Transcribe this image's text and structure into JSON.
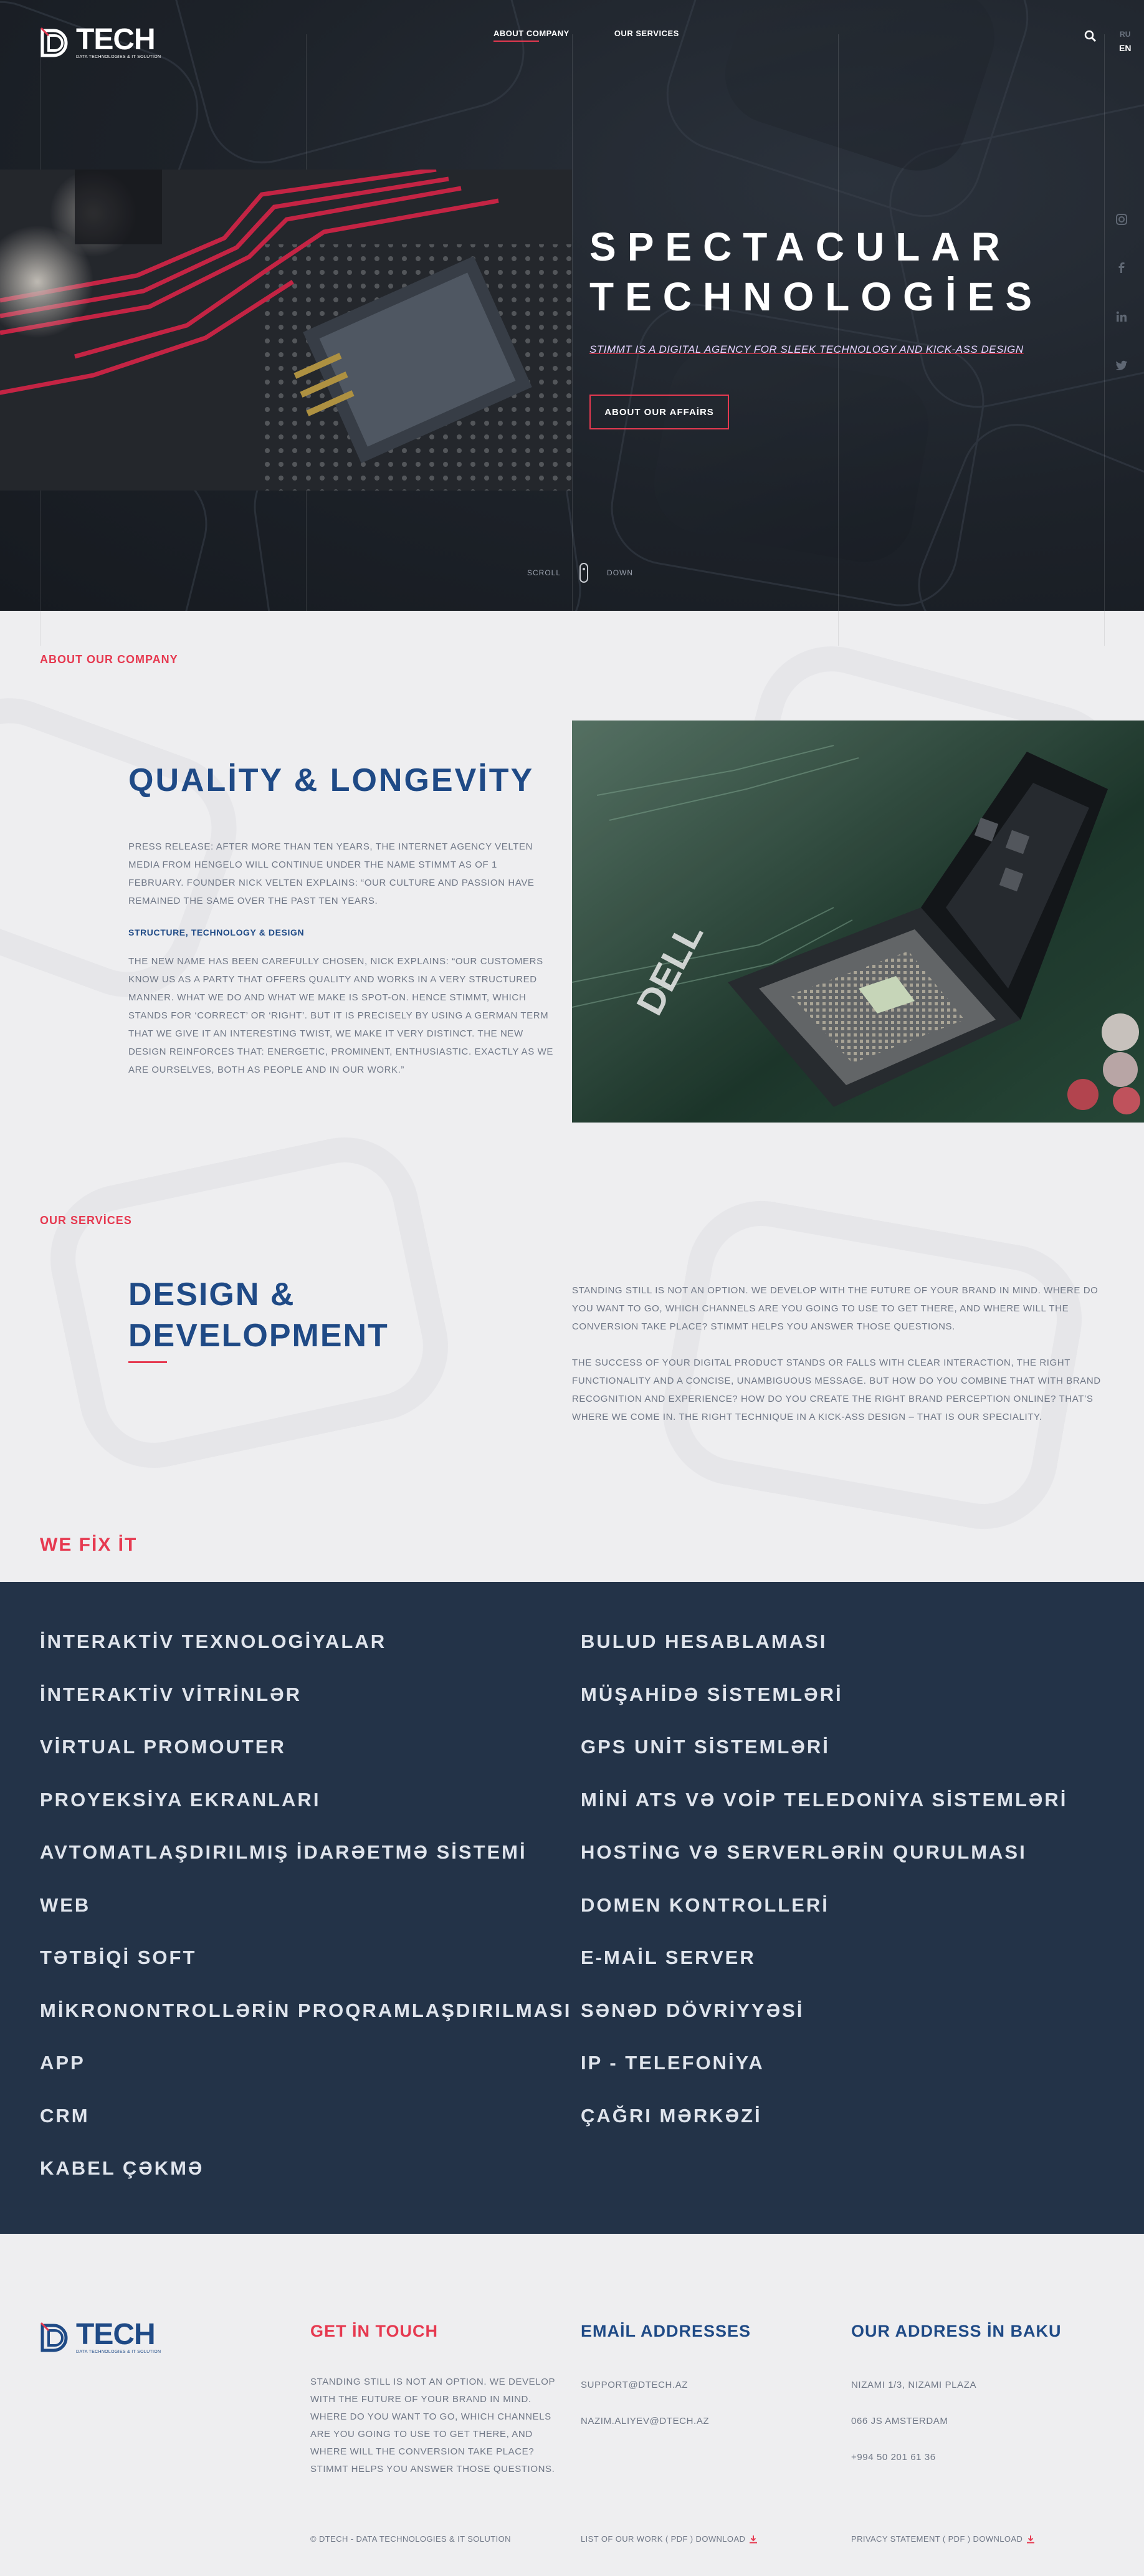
{
  "brand": {
    "word": "TECH",
    "tagline": "DATA TECHNOLOGIES & IT SOLUTION"
  },
  "nav": {
    "items": [
      "ABOUT COMPANY",
      "OUR SERVICES"
    ],
    "lang_other": "RU",
    "lang_active": "EN"
  },
  "hero": {
    "title_line1": "SPECTACULAR",
    "title_line2": "TECHNOLOGİES",
    "subtitle": "STIMMT IS A DIGITAL AGENCY FOR SLEEK TECHNOLOGY AND KICK-ASS DESIGN",
    "button": "ABOUT OUR AFFAİRS",
    "scroll_left": "SCROLL",
    "scroll_right": "DOWN"
  },
  "socials": [
    "instagram-icon",
    "facebook-icon",
    "linkedin-icon",
    "twitter-icon"
  ],
  "about": {
    "label": "ABOUT OUR COMPANY",
    "title": "QUALİTY & LONGEVİTY",
    "p1": "PRESS RELEASE: AFTER MORE THAN TEN YEARS, THE INTERNET AGENCY VELTEN MEDIA FROM HENGELO WILL CONTINUE UNDER THE NAME STIMMT AS OF 1 FEBRUARY. FOUNDER NICK VELTEN EXPLAINS: “OUR CULTURE AND PASSION HAVE REMAINED THE SAME OVER THE PAST TEN YEARS.",
    "subheading": "STRUCTURE, TECHNOLOGY & DESIGN",
    "p2": "THE NEW NAME HAS BEEN CAREFULLY CHOSEN, NICK EXPLAINS: “OUR CUSTOMERS KNOW US AS A PARTY THAT OFFERS QUALITY AND WORKS IN A VERY STRUCTURED MANNER. WHAT WE DO AND WHAT WE MAKE IS SPOT-ON. HENCE STIMMT, WHICH STANDS FOR ‘CORRECT’ OR ‘RIGHT’. BUT IT IS PRECISELY BY USING A GERMAN TERM THAT WE GIVE IT AN INTERESTING TWIST, WE MAKE IT VERY DISTINCT. THE NEW DESIGN REINFORCES THAT: ENERGETIC, PROMINENT, ENTHUSIASTIC. EXACTLY AS WE ARE OURSELVES, BOTH AS PEOPLE AND IN OUR WORK.”"
  },
  "services": {
    "label": "OUR SERVİCES",
    "title_line1": "DESIGN &",
    "title_line2": "DEVELOPMENT",
    "p1": "STANDING STILL IS NOT AN OPTION. WE DEVELOP WITH THE FUTURE OF YOUR BRAND IN MIND. WHERE DO YOU WANT TO GO, WHICH CHANNELS ARE YOU GOING TO USE TO GET THERE, AND WHERE WILL THE CONVERSION TAKE PLACE? STIMMT HELPS YOU ANSWER THOSE QUESTIONS.",
    "p2": "THE SUCCESS OF YOUR DIGITAL PRODUCT STANDS OR FALLS WITH CLEAR INTERACTION, THE RIGHT FUNCTIONALITY AND A CONCISE, UNAMBIGUOUS MESSAGE. BUT HOW DO YOU COMBINE THAT WITH BRAND RECOGNITION AND EXPERIENCE? HOW DO YOU CREATE THE RIGHT BRAND PERCEPTION ONLINE? THAT’S WHERE WE COME IN. THE RIGHT TECHNIQUE IN A KICK-ASS DESIGN – THAT IS OUR SPECIALITY."
  },
  "fix": {
    "label": "WE FİX İT",
    "left": [
      "İNTERAKTİV TEXNOLOGİYALAR",
      "İNTERAKTİV VİTRİNLƏR",
      "VİRTUAL PROMOUTER",
      "PROYEKSİYA EKRANLARI",
      "AVTOMATLAŞDIRILMIŞ İDARƏETMƏ SİSTEMİ",
      "WEB",
      "TƏTBİQİ SOFT",
      "MİKRONONTROLLƏRİN PROQRAMLAŞDIRILMASI",
      "APP",
      "CRM",
      "KABEL ÇƏKMƏ"
    ],
    "right": [
      "BULUD HESABLAMASI",
      "MÜŞAHİDƏ SİSTEMLƏRİ",
      "GPS UNİT SİSTEMLƏRİ",
      "MİNİ ATS VƏ VOİP TELEDONİYA SİSTEMLƏRİ",
      "HOSTİNG VƏ SERVERLƏRİN QURULMASI",
      "DOMEN KONTROLLERİ",
      "E-MAİL SERVER",
      "SƏNƏD DÖVRİYYƏSİ",
      "IP - TELEFONİYA",
      "ÇAĞRI MƏRKƏZİ"
    ]
  },
  "footer": {
    "touch_title": "GET İN TOUCH",
    "touch_text": "STANDING STILL IS NOT AN OPTION. WE DEVELOP WITH THE FUTURE OF YOUR BRAND IN MIND. WHERE DO YOU WANT TO GO, WHICH CHANNELS ARE YOU GOING TO USE TO GET THERE, AND WHERE WILL THE CONVERSION TAKE PLACE? STIMMT HELPS YOU ANSWER THOSE QUESTIONS.",
    "email_title": "EMAİL ADDRESSES",
    "email1": "SUPPORT@DTECH.AZ",
    "email2": "NAZIM.ALIYEV@DTECH.AZ",
    "address_title": "OUR ADDRESS İN BAKU",
    "address1": "NIZAMI 1/3, NIZAMI PLAZA",
    "address2": "066 JS AMSTERDAM",
    "phone": "+994 50 201 61 36",
    "copyright": "© DTECH - DATA TECHNOLOGIES & IT SOLUTION",
    "list_link": "LIST OF OUR WORK ( PDF ) DOWNLOAD",
    "privacy_link": "PRIVACY STATEMENT ( PDF ) DOWNLOAD"
  },
  "colors": {
    "accent": "#e63950",
    "navy": "#1f4a86",
    "panel": "#233348",
    "hero_bg": "#1d2229"
  }
}
